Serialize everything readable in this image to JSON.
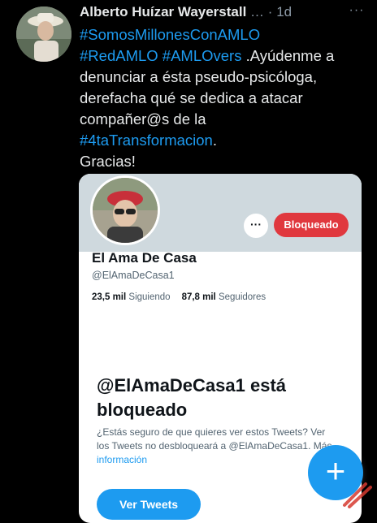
{
  "tweet": {
    "author_name": "Alberto Huízar Wayerstall",
    "handle_truncated": "…",
    "separator": "·",
    "time": "1d",
    "more_icon": "ellipsis-icon",
    "lines": [
      [
        {
          "text": "#SomosMillonesConAMLO",
          "tag": true
        }
      ],
      [
        {
          "text": "#RedAMLO",
          "tag": true
        },
        {
          "text": " ",
          "tag": false
        },
        {
          "text": "#AMLOvers",
          "tag": true
        },
        {
          "text": " .Ayúdenme a",
          "tag": false
        }
      ],
      [
        {
          "text": "denunciar a ésta pseudo-psicóloga,",
          "tag": false
        }
      ],
      [
        {
          "text": "derefacha qué se dedica a atacar",
          "tag": false
        }
      ],
      [
        {
          "text": "compañer@s de la",
          "tag": false
        }
      ],
      [
        {
          "text": "#4taTransformacion",
          "tag": true
        },
        {
          "text": ".",
          "tag": false
        }
      ],
      [
        {
          "text": "Gracias!",
          "tag": false
        }
      ]
    ]
  },
  "card": {
    "more_label": "···",
    "blocked_button": "Bloqueado",
    "name": "El Ama De Casa",
    "handle": "@ElAmaDeCasa1",
    "following_count": "23,5 mil",
    "following_label": "Siguiendo",
    "followers_count": "87,8 mil",
    "followers_label": "Seguidores",
    "blocked_title": "@ElAmaDeCasa1 está bloqueado",
    "blocked_desc_line1": "¿Estás seguro de que quieres ver estos Tweets? Ver",
    "blocked_desc_line2": "los Tweets no desbloqueará a @ElAmaDeCasa1. Más",
    "blocked_desc_link": "información",
    "view_tweets_button": "Ver Tweets"
  },
  "fab": {
    "icon": "plus-icon",
    "label": "+"
  },
  "colors": {
    "background": "#000000",
    "link": "#1d9bf0",
    "blocked_red": "#e0383e",
    "card_bg": "#ffffff"
  }
}
